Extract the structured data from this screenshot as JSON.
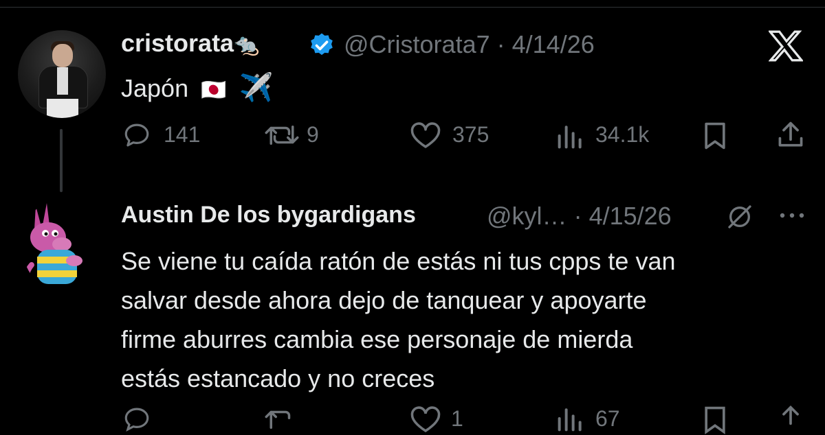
{
  "tweet": {
    "display_name": "cristorata",
    "name_emoji": "🐀",
    "handle": "@Cristorata7",
    "separator": "·",
    "date": "4/14/26",
    "text": "Japón",
    "emoji_flag": "🇯🇵",
    "emoji_plane": "✈️",
    "replies": "141",
    "reposts": "9",
    "likes": "375",
    "views": "34.1k"
  },
  "reply": {
    "display_name": "Austin De los bygardigans",
    "handle": "@kyl…",
    "separator": "·",
    "date": "4/15/26",
    "text_lines": [
      "Se viene tu caída ratón de estás ni tus cpps te van",
      "salvar desde ahora dejo de tanquear y apoyarte",
      "firme aburres cambia ese personaje de mierda",
      "estás estancado y no creces"
    ],
    "likes": "1",
    "views": "67"
  },
  "colors": {
    "background": "#000000",
    "text": "#e7e9ea",
    "muted": "#71767b",
    "verified": "#1d9bf0"
  },
  "icons": [
    "x-logo-icon",
    "verified-badge-icon",
    "reply-icon",
    "repost-icon",
    "like-icon",
    "views-icon",
    "bookmark-icon",
    "share-icon",
    "grok-icon",
    "more-icon"
  ]
}
